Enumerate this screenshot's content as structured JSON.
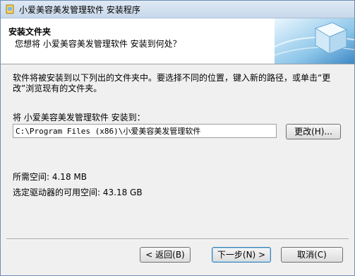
{
  "window": {
    "title": "小爱美容美发管理软件 安装程序"
  },
  "header": {
    "title": "安装文件夹",
    "subtitle": "您想将 小爱美容美发管理软件 安装到何处？"
  },
  "content": {
    "description": "软件将被安装到以下列出的文件夹中。要选择不同的位置，键入新的路径，或单击“更改”浏览现有的文件夹。",
    "destination_label": "将 小爱美容美发管理软件 安装到：",
    "destination_path": "C:\\Program Files (x86)\\小爱美容美发管理软件",
    "browse_label": "更改(H)...",
    "space_required": "所需空间: 4.18 MB",
    "space_available": "选定驱动器的可用空间: 43.18 GB"
  },
  "footer": {
    "back_label": "< 返回(B)",
    "next_label": "下一步(N) >",
    "cancel_label": "取消(C)"
  }
}
